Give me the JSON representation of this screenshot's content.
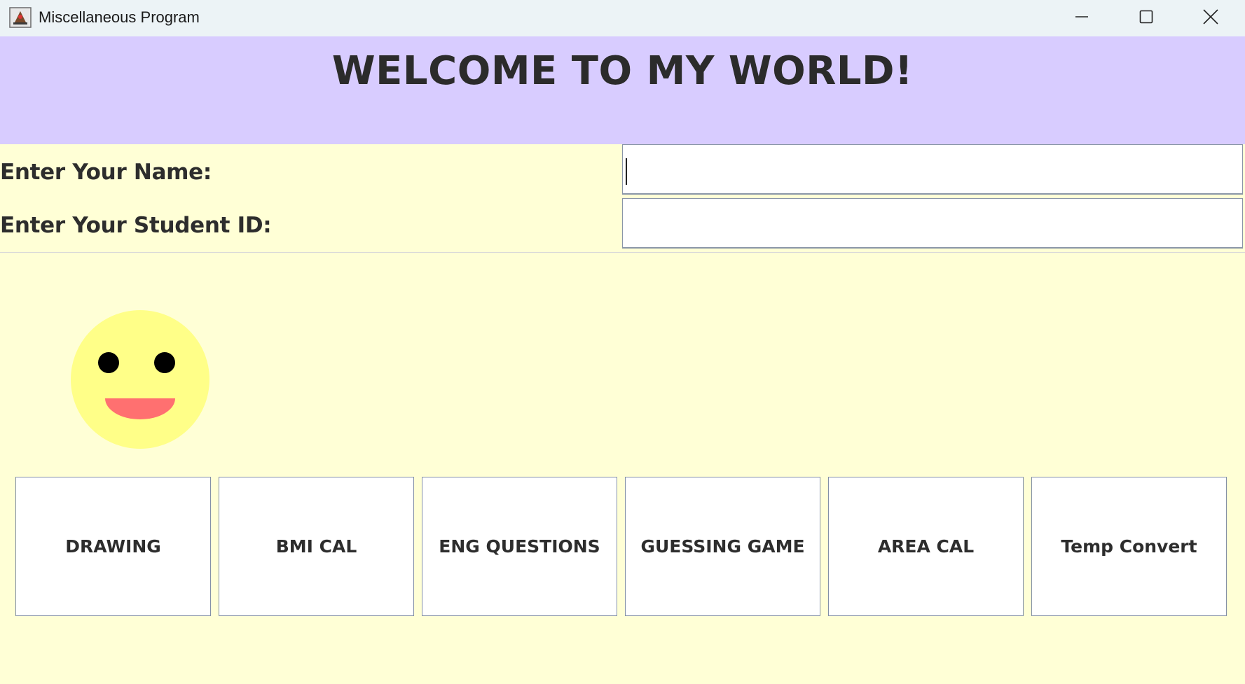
{
  "window": {
    "title": "Miscellaneous Program",
    "icon": "java-app-icon",
    "controls": [
      "minimize-icon",
      "maximize-icon",
      "close-icon"
    ]
  },
  "header": {
    "title": "WELCOME TO MY WORLD!"
  },
  "form": {
    "name_label": "Enter Your Name:",
    "name_value": "",
    "id_label": "Enter Your Student ID:",
    "id_value": ""
  },
  "smiley": {
    "face_color": "#ffff88",
    "eye_color": "#000000",
    "mouth_color": "#ff7070"
  },
  "buttons": [
    {
      "label": "DRAWING"
    },
    {
      "label": "BMI CAL"
    },
    {
      "label": "ENG QUESTIONS"
    },
    {
      "label": "GUESSING GAME"
    },
    {
      "label": "AREA CAL"
    },
    {
      "label": "Temp Convert"
    }
  ],
  "colors": {
    "header_bg": "#d8ccff",
    "body_bg": "#ffffd6",
    "titlebar_bg": "#ecf3f6"
  }
}
